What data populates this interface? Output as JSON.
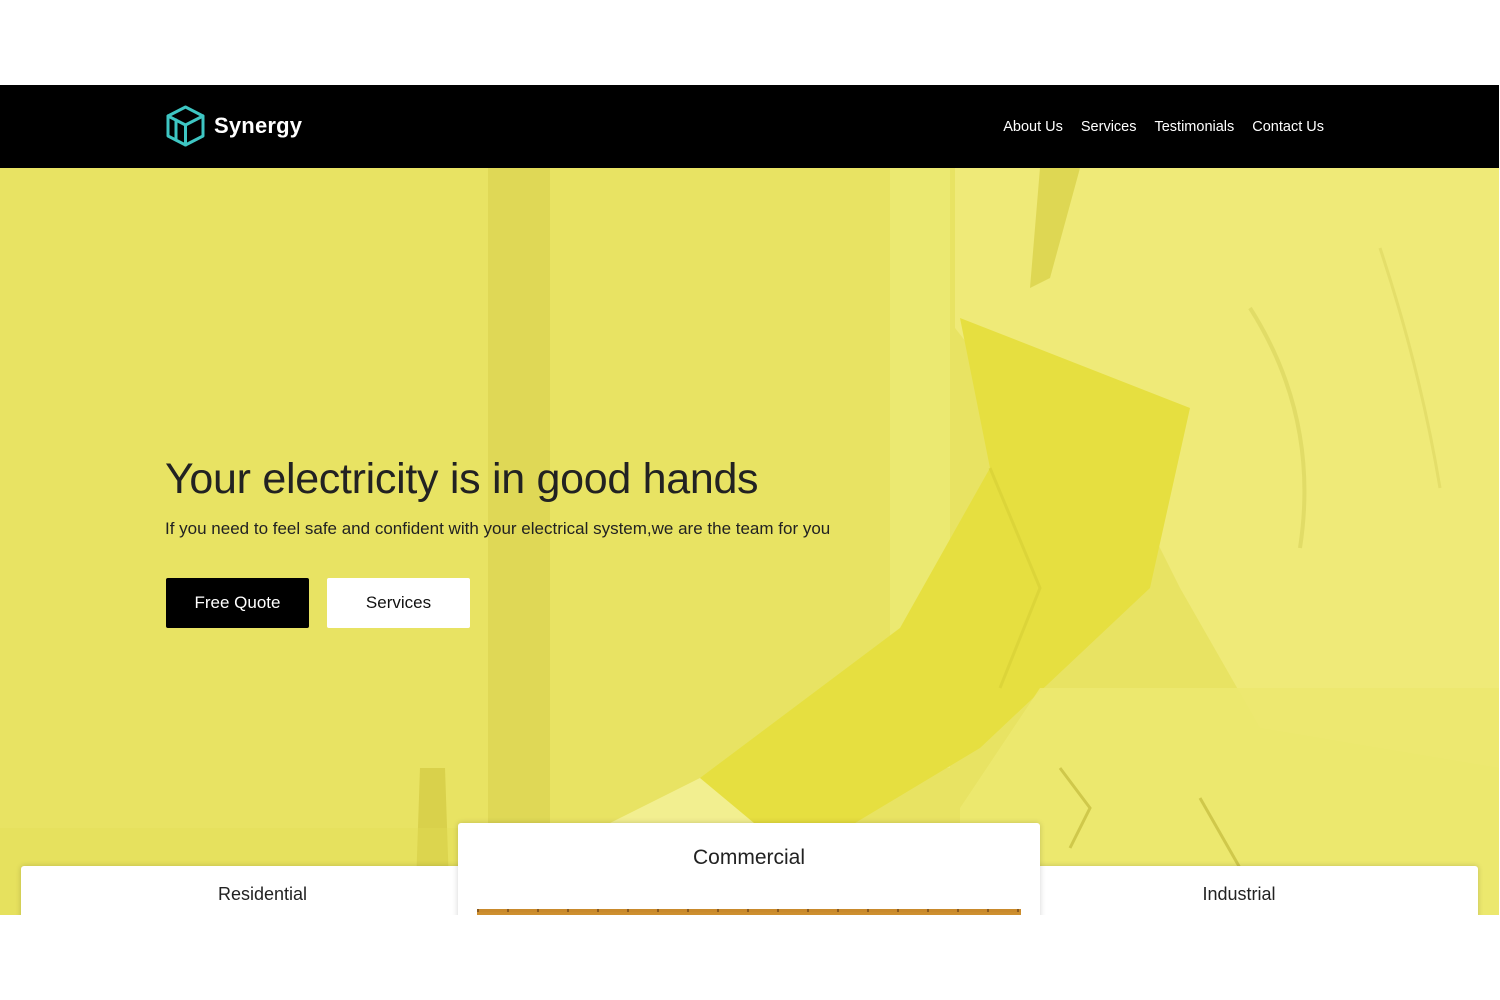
{
  "brand": {
    "name": "Synergy",
    "icon": "cube-logo-icon",
    "logo_color": "#3ec6c3"
  },
  "nav": {
    "items": [
      {
        "label": "About Us"
      },
      {
        "label": "Services"
      },
      {
        "label": "Testimonials"
      },
      {
        "label": "Contact Us"
      }
    ]
  },
  "hero": {
    "title": "Your electricity is in good hands",
    "subtitle": "If you need to feel safe and confident with your electrical system,we are the team for you",
    "overlay_color": "#e8e363",
    "buttons": {
      "primary_label": "Free Quote",
      "secondary_label": "Services"
    }
  },
  "cards": [
    {
      "title": "Residential"
    },
    {
      "title": "Commercial"
    },
    {
      "title": "Industrial"
    }
  ],
  "colors": {
    "navbar": "#000000",
    "primary_button": "#000000",
    "secondary_button": "#ffffff"
  }
}
